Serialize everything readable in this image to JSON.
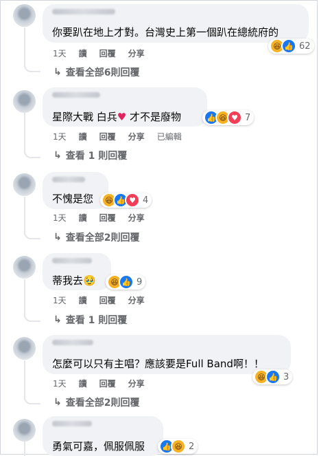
{
  "actions": {
    "time": "1天",
    "read": "讀",
    "reply": "回覆",
    "share": "分享",
    "edited": "已編輯"
  },
  "colors": {
    "haha": "#f7b125",
    "like": "#1877f2",
    "love": "#f33e58",
    "muted": "#65676b",
    "bubble": "#f0f2f5"
  },
  "comments": [
    {
      "text": "你要趴在地上才對。台灣史上第一個趴在總統府的",
      "reactions": [
        "haha",
        "like"
      ],
      "count": "62",
      "replies_label": "查看全部6則回覆"
    },
    {
      "text_before": "星際大戰 白兵",
      "heart_icon": "heart-icon",
      "text_after": " 才不是廢物",
      "reactions": [
        "like",
        "haha",
        "love"
      ],
      "count": "7",
      "replies_label": "查看 1 則回覆"
    },
    {
      "text": "不愧是您",
      "reactions": [
        "haha",
        "like",
        "love"
      ],
      "count": "4",
      "replies_label": "查看全部2則回覆"
    },
    {
      "text": "蒂我去",
      "emoji": "🥹",
      "reactions": [
        "haha",
        "like"
      ],
      "count": "9",
      "replies_label": "查看 1 則回覆"
    },
    {
      "text": "怎麼可以只有主唱？應該要是Full Band啊！！",
      "reactions": [
        "haha",
        "like"
      ],
      "count": "3",
      "replies_label": "查看全部2則回覆"
    },
    {
      "text": "勇氣可嘉，佩服佩服",
      "reactions": [
        "like",
        "haha"
      ],
      "count": "2"
    }
  ],
  "icons": {
    "reply_arrow": "reply-arrow-icon",
    "haha": "haha-reaction-icon",
    "like": "like-reaction-icon",
    "love": "love-reaction-icon"
  }
}
